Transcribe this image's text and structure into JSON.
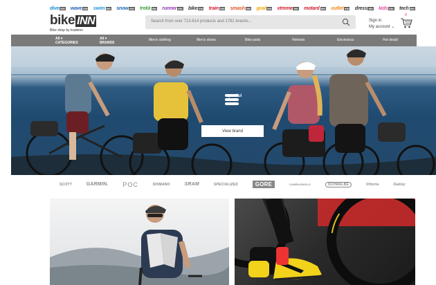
{
  "stores": [
    {
      "name": "dive",
      "color": "#1a8fd6"
    },
    {
      "name": "wave",
      "color": "#1f5fb8"
    },
    {
      "name": "swim",
      "color": "#2a97e0"
    },
    {
      "name": "snow",
      "color": "#1e63b5"
    },
    {
      "name": "trekk",
      "color": "#3ca33c"
    },
    {
      "name": "runner",
      "color": "#8e3ab0"
    },
    {
      "name": "bike",
      "color": "#333333"
    },
    {
      "name": "train",
      "color": "#d4192c"
    },
    {
      "name": "smash",
      "color": "#e2542a"
    },
    {
      "name": "goal",
      "color": "#f0a800"
    },
    {
      "name": "xtreme",
      "color": "#d4192c"
    },
    {
      "name": "motard",
      "color": "#c91d2d"
    },
    {
      "name": "outlet",
      "color": "#f08b1c"
    },
    {
      "name": "dress",
      "color": "#333333"
    },
    {
      "name": "kids",
      "color": "#e94aa0"
    },
    {
      "name": "tech",
      "color": "#333333"
    }
  ],
  "store_suffix": "INN",
  "header": {
    "logo_main": "bike",
    "logo_box": "INN",
    "tagline": "Bike shop by tradeinn",
    "search_placeholder": "Search from over 710.614 products and 1781 brands...",
    "signin": "Sign in",
    "account": "My account",
    "cart_count": "0"
  },
  "nav": {
    "all_label": "All",
    "categories": "CATEGORIES",
    "brands": "BRANDS",
    "items": [
      "Men's clothing",
      "Men's shoes",
      "Bike parts",
      "Helmets",
      "Electronics",
      "Hot deals!"
    ]
  },
  "hero": {
    "brand_name": "sportful",
    "button_label": "View brand"
  },
  "brands_strip": [
    "SCOTT",
    "GARMIN.",
    "POC",
    "SHIMANO",
    "SRAM",
    "SPECIALIZED",
    "GORE",
    "CAMPAGNOLO",
    "SCHWALBE",
    "Vittoria",
    "Oakley"
  ],
  "colors": {
    "nav_bg": "#7a7a7a",
    "search_bg": "#e6e6e6",
    "cart_badge": "#e22244",
    "shoe_yellow": "#f2d21a"
  }
}
